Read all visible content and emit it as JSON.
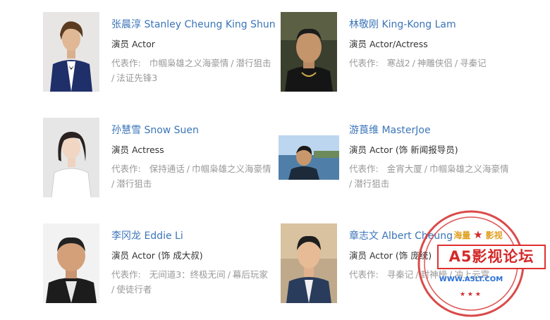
{
  "actors": [
    {
      "name": "张晨淳 Stanley Cheung King Shun",
      "role": "演员 Actor",
      "works_label": "代表作:",
      "works": [
        "巾帼枭雄之义海豪情",
        "潜行狙击",
        "法证先锋3"
      ]
    },
    {
      "name": "林敬刚 King-Kong Lam",
      "role": "演员 Actor/Actress",
      "works_label": "代表作:",
      "works": [
        "寒战2",
        "神雕侠侣",
        "寻秦记"
      ]
    },
    {
      "name": "孙慧雪 Snow Suen",
      "role": "演员 Actress",
      "works_label": "代表作:",
      "works": [
        "保持通话",
        "巾帼枭雄之义海豪情",
        "潜行狙击"
      ]
    },
    {
      "name": "游莨维 MasterJoe",
      "role": "演员 Actor (饰 新闻报导员)",
      "works_label": "代表作:",
      "works": [
        "金宵大厦",
        "巾帼枭雄之义海豪情",
        "潜行狙击"
      ]
    },
    {
      "name": "李冈龙 Eddie Li",
      "role": "演员 Actor (饰 成大叔)",
      "works_label": "代表作:",
      "works": [
        "无间道3：终极无间",
        "幕后玩家",
        "使徒行者"
      ]
    },
    {
      "name": "章志文 Albert Cheung",
      "role": "演员 Actor (饰 庞统)",
      "works_label": "代表作:",
      "works": [
        "寻秦记",
        "封神榜",
        "冲上云霄"
      ]
    }
  ],
  "stamp": {
    "top_left": "海量",
    "top_right": "影视",
    "title": "A5影视论坛",
    "url": "WWW.A5LT.COM"
  },
  "colors": {
    "name_link": "#3b75b8",
    "role_text": "#333333",
    "works_text": "#999999",
    "stamp_red": "#d42a2a",
    "stamp_gold": "#e0a020",
    "stamp_blue": "#2a6fd6"
  }
}
